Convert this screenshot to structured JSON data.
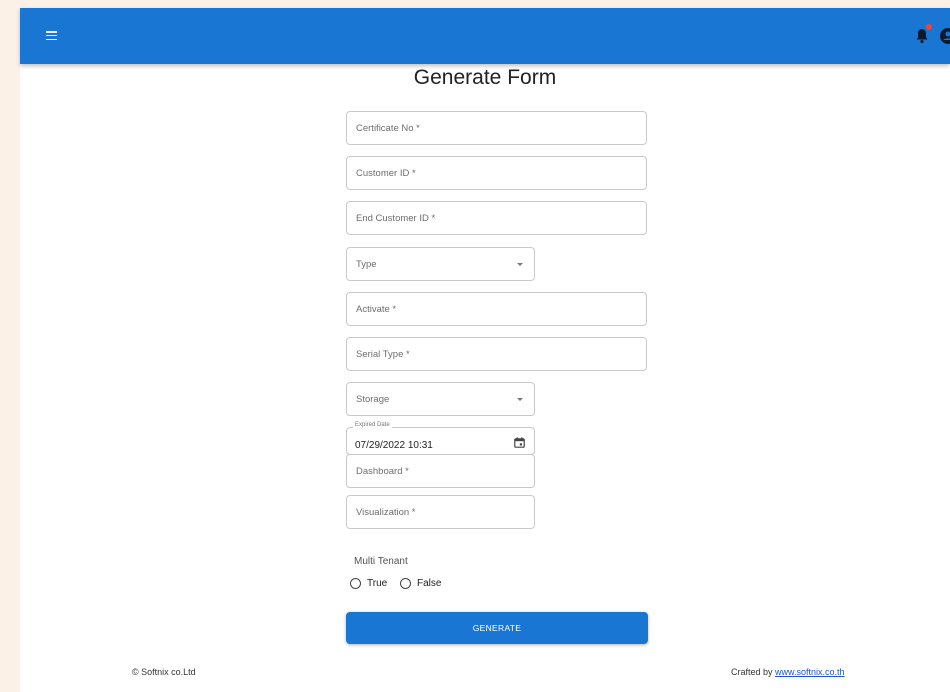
{
  "header": {
    "menu_icon": "hamburger-menu-icon",
    "notifications_icon": "bell-icon",
    "account_icon": "account-circle-icon",
    "brand_color": "#1976d2"
  },
  "page": {
    "title": "Generate Form"
  },
  "form": {
    "certificate_no": {
      "label": "Certificate No *",
      "value": ""
    },
    "customer_id": {
      "label": "Customer ID *",
      "value": ""
    },
    "end_customer_id": {
      "label": "End Customer ID *",
      "value": ""
    },
    "type": {
      "label": "Type",
      "value": ""
    },
    "activate": {
      "label": "Activate *",
      "value": ""
    },
    "serial_type": {
      "label": "Serial Type *",
      "value": ""
    },
    "storage": {
      "label": "Storage",
      "value": ""
    },
    "expired_date": {
      "label": "Expired Date",
      "value": "07/29/2022 10:31"
    },
    "dashboard": {
      "label": "Dashboard *",
      "value": ""
    },
    "visualization": {
      "label": "Visualization *",
      "value": ""
    },
    "multi_tenant": {
      "label": "Multi Tenant",
      "options": [
        "True",
        "False"
      ],
      "selected": null
    },
    "generate_label": "GENERATE"
  },
  "footer": {
    "copyright": "© Softnix co.Ltd",
    "crafted_prefix": "Crafted by ",
    "crafted_link": "www.softnix.co.th"
  }
}
